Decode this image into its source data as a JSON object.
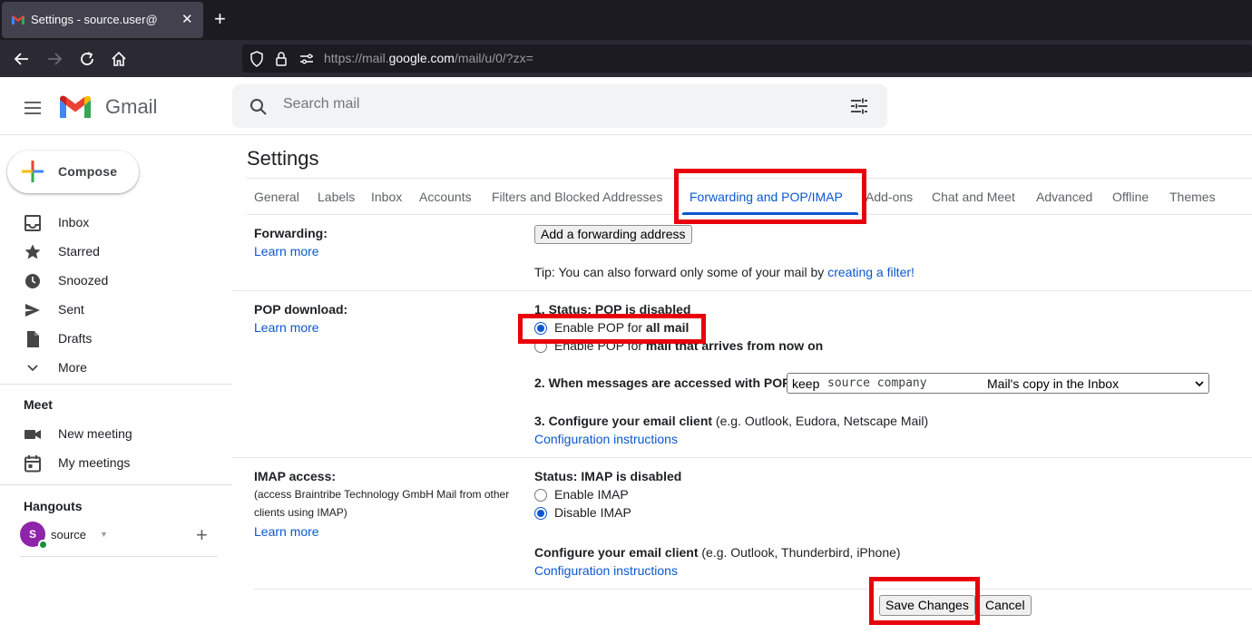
{
  "browser": {
    "tab_title": "Settings - source.user@",
    "url_prefix": "https://mail.",
    "url_domain": "google.com",
    "url_suffix": "/mail/u/0/?zx="
  },
  "gmail": {
    "logo_text": "Gmail",
    "search_placeholder": "Search mail"
  },
  "sidebar": {
    "compose": "Compose",
    "items": [
      {
        "label": "Inbox",
        "icon": "inbox-icon"
      },
      {
        "label": "Starred",
        "icon": "star-icon"
      },
      {
        "label": "Snoozed",
        "icon": "clock-icon"
      },
      {
        "label": "Sent",
        "icon": "send-icon"
      },
      {
        "label": "Drafts",
        "icon": "draft-icon"
      },
      {
        "label": "More",
        "icon": "chevron-down-icon"
      }
    ],
    "meet_title": "Meet",
    "meet_items": [
      {
        "label": "New meeting",
        "icon": "video-icon"
      },
      {
        "label": "My meetings",
        "icon": "calendar-icon"
      }
    ],
    "hangouts_title": "Hangouts",
    "hangouts_user": {
      "initial": "S",
      "name": "source"
    }
  },
  "settings": {
    "title": "Settings",
    "tabs": [
      "General",
      "Labels",
      "Inbox",
      "Accounts",
      "Filters and Blocked Addresses",
      "Forwarding and POP/IMAP",
      "Add-ons",
      "Chat and Meet",
      "Advanced",
      "Offline",
      "Themes"
    ],
    "active_tab": "Forwarding and POP/IMAP",
    "forwarding": {
      "label": "Forwarding:",
      "learn_more": "Learn more",
      "add_button": "Add a forwarding address",
      "tip_text": "Tip: You can also forward only some of your mail by ",
      "tip_link": "creating a filter!"
    },
    "pop": {
      "label": "POP download:",
      "learn_more": "Learn more",
      "status": "1. Status: POP is disabled",
      "option1_prefix": "Enable POP for ",
      "option1_bold": "all mail",
      "option2_prefix": "Enable POP for ",
      "option2_bold": "mail that arrives from now on",
      "selected_option": 1,
      "step2_label": "2. When messages are accessed with POP",
      "step2_select_a": "keep",
      "step2_select_b": "source company",
      "step2_select_c": "Mail's copy in the Inbox",
      "step3_label": "3. Configure your email client",
      "step3_hint": " (e.g. Outlook, Eudora, Netscape Mail)",
      "config_link": "Configuration instructions"
    },
    "imap": {
      "label": "IMAP access:",
      "description": "(access Braintribe Technology GmbH Mail from other clients using IMAP)",
      "learn_more": "Learn more",
      "status": "Status: IMAP is disabled",
      "enable": "Enable IMAP",
      "disable": "Disable IMAP",
      "selected": "disable",
      "configure_label": "Configure your email client",
      "configure_hint": " (e.g. Outlook, Thunderbird, iPhone)",
      "config_link": "Configuration instructions"
    },
    "save": "Save Changes",
    "cancel": "Cancel"
  },
  "highlight_color": "#e8000b",
  "accent_color": "#0b57d0"
}
